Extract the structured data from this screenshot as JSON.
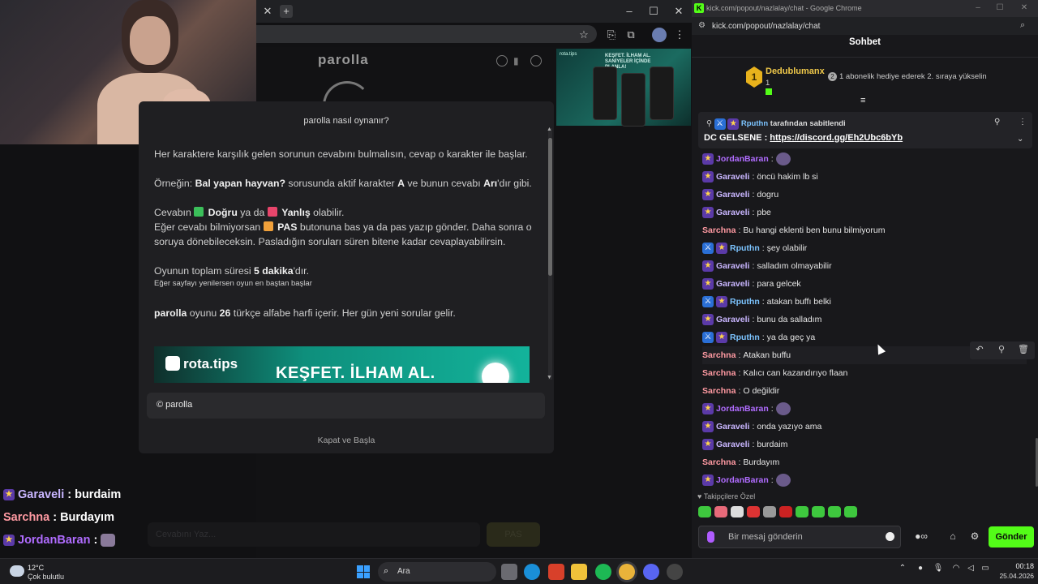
{
  "browser": {
    "new_tab_icon": "plus-icon",
    "close_tab_icon": "close-icon",
    "star_icon": "star-icon",
    "extensions_icon": "puzzle-icon",
    "menu_icon": "kebab-icon"
  },
  "site": {
    "logo": "parolla",
    "ad_text": "KEŞFET. İLHAM AL. SANİYELER İÇİNDE PLANLA!",
    "ad_brand": "rota.tips"
  },
  "modal": {
    "title": "parolla nasıl oynanır?",
    "p1": "Her karaktere karşılık gelen sorunun cevabını bulmalısın, cevap o karakter ile başlar.",
    "p2_pre": "Örneğin: ",
    "p2_b1": "Bal yapan hayvan?",
    "p2_mid": " sorusunda aktif karakter ",
    "p2_b2": "A",
    "p2_mid2": " ve bunun cevabı ",
    "p2_b3": "Arı",
    "p2_post": "'dır gibi.",
    "p3_pre": "Cevabın ",
    "p3_correct": "Doğru",
    "p3_mid": " ya da ",
    "p3_wrong": "Yanlış",
    "p3_post": " olabilir.",
    "p4_pre": "Eğer cevabı bilmiyorsan ",
    "p4_pas": "PAS",
    "p4_post": " butonuna bas ya da pas yazıp gönder. Daha sonra o soruya dönebileceksin. Pasladığın soruları süren bitene kadar cevaplayabilirsin.",
    "p5_pre": "Oyunun toplam süresi ",
    "p5_b": "5 dakika",
    "p5_post": "'dır.",
    "p5_small": "Eğer sayfayı yenilersen oyun en baştan başlar",
    "p6_b1": "parolla",
    "p6_mid": " oyunu ",
    "p6_b2": "26",
    "p6_post": " türkçe alfabe harfi içerir. Her gün yeni sorular gelir.",
    "banner_logo": "rota.tips",
    "banner_headline": "KEŞFET. İLHAM AL.",
    "input_value": "© parolla",
    "close_button": "Kapat ve Başla"
  },
  "game": {
    "answer_placeholder": "Cevabını Yaz...",
    "pas_button": "PAS"
  },
  "overlay_chat": [
    {
      "user": "Garaveli",
      "text": "burdaim",
      "color": "#c9b6ff"
    },
    {
      "user": "Sarchna",
      "text": "Burdayım",
      "color": "#ff9aa2"
    },
    {
      "user": "JordanBaran",
      "text": "",
      "color": "#b06cff"
    }
  ],
  "popout": {
    "window_title": "kick.com/popout/nazlalay/chat - Google Chrome",
    "url": "kick.com/popout/nazlalay/chat",
    "header": "Sohbet",
    "leader_rank": "1",
    "leader_name": "Dedublumanx",
    "leader_count": "1",
    "leader_msg": "1 abonelik hediye ederek 2. sıraya yükselin",
    "leader_msg_num": "2",
    "pinned_by": "Rputhn",
    "pinned_label": "tarafından sabitlendi",
    "pinned_msg_pre": "DC GELSENE : ",
    "pinned_link": "https://discord.gg/Eh2Ubc6bYb",
    "follower_label": "Takipçilere Özel",
    "input_placeholder": "Bir mesaj gönderin",
    "send_button": "Gönder"
  },
  "chat_messages": [
    {
      "user": "JordanBaran",
      "text": "",
      "color": "#b06cff",
      "badge": true,
      "emote": true
    },
    {
      "user": "Garaveli",
      "text": "öncü hakim lb si",
      "color": "#c9b6ff",
      "badge": true
    },
    {
      "user": "Garaveli",
      "text": "dogru",
      "color": "#c9b6ff",
      "badge": true
    },
    {
      "user": "Garaveli",
      "text": "pbe",
      "color": "#c9b6ff",
      "badge": true
    },
    {
      "user": "Sarchna",
      "text": "Bu hangi eklenti ben bunu bilmiyorum",
      "color": "#ff9aa2",
      "badge": false
    },
    {
      "user": "Rputhn",
      "text": "şey olabilir",
      "color": "#7cc4ff",
      "badge": true,
      "mod": true
    },
    {
      "user": "Garaveli",
      "text": "salladım olmayabilir",
      "color": "#c9b6ff",
      "badge": true
    },
    {
      "user": "Garaveli",
      "text": "para gelcek",
      "color": "#c9b6ff",
      "badge": true
    },
    {
      "user": "Rputhn",
      "text": "atakan buffı belki",
      "color": "#7cc4ff",
      "badge": true,
      "mod": true
    },
    {
      "user": "Garaveli",
      "text": "bunu da salladım",
      "color": "#c9b6ff",
      "badge": true
    },
    {
      "user": "Rputhn",
      "text": "ya da geç ya",
      "color": "#7cc4ff",
      "badge": true,
      "mod": true
    },
    {
      "user": "Sarchna",
      "text": "Atakan buffu",
      "color": "#ff9aa2",
      "badge": false
    },
    {
      "user": "Sarchna",
      "text": "Kalıcı can kazandırıyo flaan",
      "color": "#ff9aa2",
      "badge": false
    },
    {
      "user": "Sarchna",
      "text": "O değildir",
      "color": "#ff9aa2",
      "badge": false
    },
    {
      "user": "JordanBaran",
      "text": "",
      "color": "#b06cff",
      "badge": true,
      "emote": true
    },
    {
      "user": "Garaveli",
      "text": "onda yazıyo ama",
      "color": "#c9b6ff",
      "badge": true
    },
    {
      "user": "Garaveli",
      "text": "burdaim",
      "color": "#c9b6ff",
      "badge": true
    },
    {
      "user": "Sarchna",
      "text": "Burdayım",
      "color": "#ff9aa2",
      "badge": false
    },
    {
      "user": "JordanBaran",
      "text": "",
      "color": "#b06cff",
      "badge": true,
      "emote": true
    }
  ],
  "taskbar": {
    "temp": "12°C",
    "weather": "Çok bulutlu",
    "search": "Ara",
    "time": "00:18",
    "date": "25.04.2026"
  },
  "colors": {
    "kick_green": "#53fc18",
    "correct": "#3bbf5a",
    "wrong": "#e8456b",
    "pas": "#f0a03a"
  }
}
